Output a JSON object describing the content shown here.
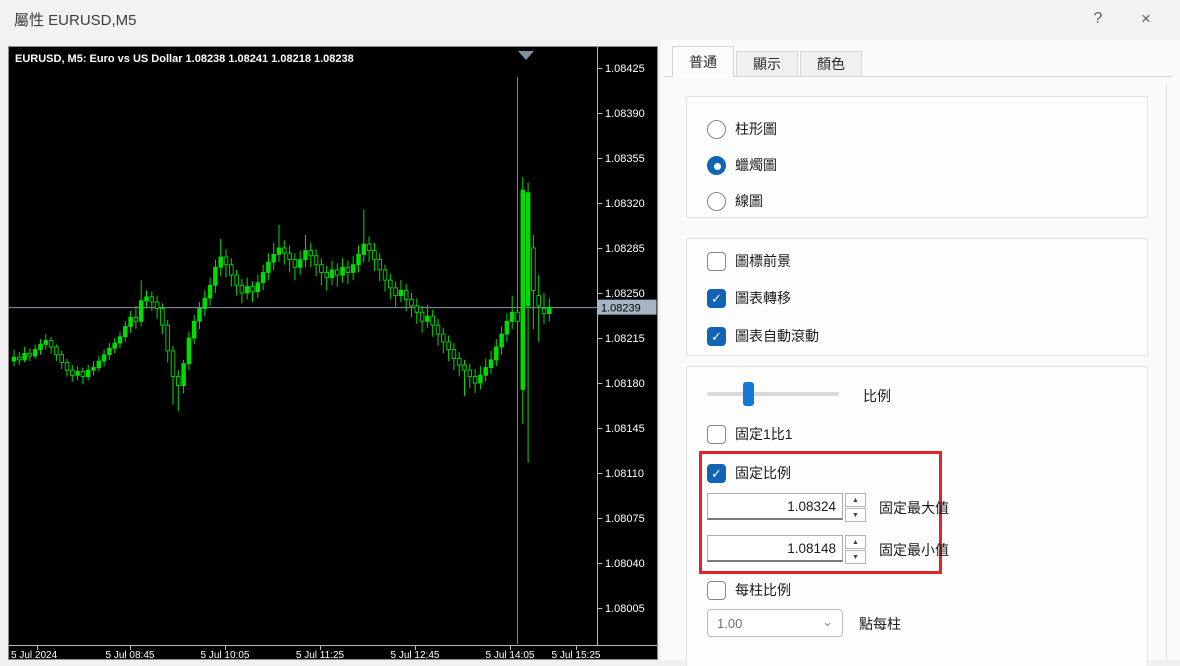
{
  "window": {
    "title": "屬性 EURUSD,M5",
    "help_label": "?",
    "close_label": "×"
  },
  "chart": {
    "header": "EURUSD, M5:  Euro vs US Dollar  1.08238 1.08241 1.08218 1.08238",
    "current_price_label": "1.08239",
    "price_labels": [
      "1.08425",
      "1.08390",
      "1.08355",
      "1.08320",
      "1.08285",
      "1.08250",
      "1.08215",
      "1.08180",
      "1.08145",
      "1.08110",
      "1.08075",
      "1.08040",
      "1.08005"
    ],
    "time_labels": [
      "5 Jul 2024",
      "5 Jul 08:45",
      "5 Jul 10:05",
      "5 Jul 11:25",
      "5 Jul 12:45",
      "5 Jul 14:05",
      "5 Jul 15:25"
    ],
    "colors": {
      "background": "#000000",
      "bull": "#00dc00",
      "bear_fill": "#000000",
      "price_line": "#8c9aae",
      "price_tag_bg": "#a7b4c5",
      "axis_text": "#ffffff",
      "marker": "#7d90a5"
    }
  },
  "chart_data": {
    "type": "candlestick",
    "symbol": "EURUSD",
    "timeframe": "M5",
    "ohlc": {
      "open": "1.08238",
      "high": "1.08241",
      "low": "1.08218",
      "close": "1.08238"
    },
    "y_axis": {
      "max": 1.08425,
      "min": 1.08005,
      "step": 0.00035
    },
    "current_price": 1.08239,
    "price_base": 1.08,
    "price_unit": 1e-05,
    "candles": [
      [
        197,
        206,
        193,
        200
      ],
      [
        200,
        204,
        194,
        198
      ],
      [
        198,
        208,
        196,
        203
      ],
      [
        203,
        207,
        197,
        201
      ],
      [
        201,
        210,
        199,
        206
      ],
      [
        206,
        214,
        202,
        210
      ],
      [
        210,
        218,
        206,
        213
      ],
      [
        213,
        216,
        203,
        208
      ],
      [
        208,
        210,
        197,
        202
      ],
      [
        202,
        205,
        191,
        196
      ],
      [
        196,
        199,
        185,
        190
      ],
      [
        190,
        194,
        181,
        186
      ],
      [
        186,
        193,
        182,
        189
      ],
      [
        189,
        192,
        179,
        185
      ],
      [
        185,
        194,
        182,
        190
      ],
      [
        190,
        197,
        186,
        192
      ],
      [
        192,
        201,
        189,
        197
      ],
      [
        197,
        206,
        193,
        202
      ],
      [
        202,
        211,
        198,
        207
      ],
      [
        207,
        215,
        203,
        211
      ],
      [
        211,
        220,
        207,
        216
      ],
      [
        216,
        228,
        212,
        224
      ],
      [
        224,
        236,
        219,
        231
      ],
      [
        231,
        240,
        222,
        228
      ],
      [
        228,
        260,
        224,
        244
      ],
      [
        244,
        252,
        238,
        247
      ],
      [
        247,
        251,
        236,
        243
      ],
      [
        243,
        248,
        230,
        238
      ],
      [
        238,
        242,
        218,
        225
      ],
      [
        225,
        229,
        196,
        205
      ],
      [
        205,
        209,
        163,
        185
      ],
      [
        185,
        190,
        158,
        178
      ],
      [
        178,
        198,
        172,
        195
      ],
      [
        195,
        220,
        190,
        215
      ],
      [
        215,
        233,
        210,
        228
      ],
      [
        228,
        243,
        222,
        238
      ],
      [
        238,
        252,
        232,
        246
      ],
      [
        246,
        262,
        240,
        256
      ],
      [
        256,
        276,
        250,
        270
      ],
      [
        270,
        292,
        263,
        278
      ],
      [
        278,
        284,
        262,
        272
      ],
      [
        272,
        277,
        255,
        264
      ],
      [
        264,
        268,
        248,
        256
      ],
      [
        256,
        261,
        242,
        250
      ],
      [
        250,
        262,
        245,
        255
      ],
      [
        255,
        259,
        243,
        251
      ],
      [
        251,
        264,
        246,
        258
      ],
      [
        258,
        272,
        252,
        266
      ],
      [
        266,
        281,
        260,
        274
      ],
      [
        274,
        289,
        268,
        280
      ],
      [
        280,
        303,
        274,
        285
      ],
      [
        285,
        291,
        272,
        281
      ],
      [
        281,
        287,
        266,
        276
      ],
      [
        276,
        281,
        260,
        270
      ],
      [
        270,
        283,
        264,
        276
      ],
      [
        276,
        295,
        270,
        283
      ],
      [
        283,
        289,
        270,
        279
      ],
      [
        279,
        284,
        263,
        272
      ],
      [
        272,
        277,
        256,
        266
      ],
      [
        266,
        271,
        252,
        262
      ],
      [
        262,
        275,
        256,
        268
      ],
      [
        268,
        273,
        255,
        264
      ],
      [
        264,
        277,
        258,
        270
      ],
      [
        270,
        275,
        257,
        266
      ],
      [
        266,
        279,
        260,
        272
      ],
      [
        272,
        287,
        266,
        280
      ],
      [
        280,
        315,
        274,
        288
      ],
      [
        288,
        294,
        274,
        283
      ],
      [
        283,
        289,
        267,
        276
      ],
      [
        276,
        281,
        259,
        268
      ],
      [
        268,
        272,
        251,
        260
      ],
      [
        260,
        265,
        245,
        254
      ],
      [
        254,
        259,
        239,
        248
      ],
      [
        248,
        260,
        243,
        252
      ],
      [
        252,
        257,
        236,
        245
      ],
      [
        245,
        250,
        231,
        240
      ],
      [
        240,
        246,
        226,
        235
      ],
      [
        235,
        240,
        219,
        228
      ],
      [
        228,
        241,
        223,
        232
      ],
      [
        232,
        237,
        216,
        225
      ],
      [
        225,
        230,
        209,
        218
      ],
      [
        218,
        223,
        203,
        212
      ],
      [
        212,
        217,
        197,
        206
      ],
      [
        206,
        211,
        190,
        199
      ],
      [
        199,
        204,
        185,
        194
      ],
      [
        194,
        198,
        170,
        190
      ],
      [
        190,
        195,
        176,
        185
      ],
      [
        185,
        191,
        172,
        180
      ],
      [
        180,
        193,
        175,
        186
      ],
      [
        186,
        199,
        181,
        192
      ],
      [
        192,
        205,
        187,
        198
      ],
      [
        198,
        214,
        193,
        208
      ],
      [
        208,
        224,
        202,
        218
      ],
      [
        218,
        234,
        212,
        228
      ],
      [
        228,
        248,
        222,
        235
      ],
      [
        235,
        418,
        -27,
        228
      ],
      [
        175,
        340,
        148,
        330
      ],
      [
        240,
        336,
        118,
        328
      ],
      [
        285,
        295,
        222,
        252
      ],
      [
        248,
        264,
        212,
        240
      ],
      [
        238,
        250,
        226,
        234
      ],
      [
        234,
        246,
        228,
        239
      ]
    ]
  },
  "panel": {
    "tabs": [
      {
        "name": "general",
        "label": "普通",
        "active": true
      },
      {
        "name": "show",
        "label": "顯示",
        "active": false
      },
      {
        "name": "colors",
        "label": "顏色",
        "active": false
      }
    ],
    "chart_type": {
      "options": [
        {
          "name": "bar-chart",
          "label": "柱形圖",
          "selected": false
        },
        {
          "name": "candlestick-chart",
          "label": "蠟燭圖",
          "selected": true
        },
        {
          "name": "line-chart",
          "label": "線圖",
          "selected": false
        }
      ]
    },
    "options": {
      "items": [
        {
          "name": "chart-foreground",
          "label": "圖標前景",
          "checked": false
        },
        {
          "name": "chart-shift",
          "label": "圖表轉移",
          "checked": true
        },
        {
          "name": "chart-autoscroll",
          "label": "圖表自動滾動",
          "checked": true
        }
      ]
    },
    "scale": {
      "slider_label": "比例",
      "slider_fraction": 0.3,
      "fixed_one_to_one": {
        "label": "固定1比1",
        "checked": false
      },
      "fixed_scale": {
        "label": "固定比例",
        "checked": true
      },
      "fixed_max": {
        "value": "1.08324",
        "label": "固定最大值"
      },
      "fixed_min": {
        "value": "1.08148",
        "label": "固定最小值"
      },
      "scale_per_bar": {
        "label": "每柱比例",
        "checked": false
      },
      "points_per_bar": {
        "value": "1.00",
        "label": "點每柱",
        "disabled": true
      },
      "highlight_color": "#e12525",
      "spin_up_glyph": "▲",
      "spin_down_glyph": "▼",
      "dropdown_chevron": "⌄"
    }
  }
}
